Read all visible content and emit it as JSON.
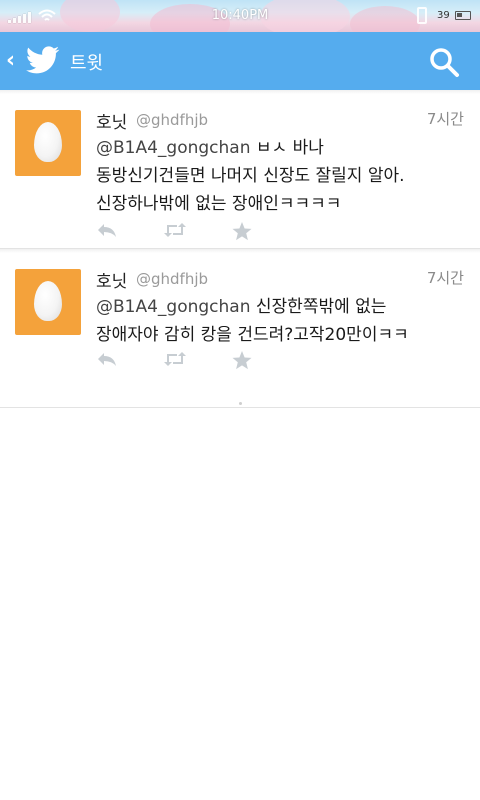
{
  "status_bar": {
    "time": "10:40PM",
    "battery_level": "39"
  },
  "app_bar": {
    "title": "트윗",
    "back_icon": "chevron-left-icon",
    "logo_icon": "twitter-bird-icon",
    "search_icon": "search-icon"
  },
  "colors": {
    "accent": "#55acee",
    "avatar_bg": "#f4a23b"
  },
  "tweets": [
    {
      "name": "호닛",
      "handle": "@ghdfhjb",
      "time": "7시간",
      "mention": "@B1A4_gongchan",
      "text": " ㅂㅅ 바나\n동방신기건들면 나머지 신장도 잘릴지 알아.\n신장하나밖에 없는 장애인ㅋㅋㅋㅋ"
    },
    {
      "name": "호닛",
      "handle": "@ghdfhjb",
      "time": "7시간",
      "mention": "@B1A4_gongchan",
      "text": " 신장한쪽밖에 없는\n장애자야 감히 캉을 건드려?고작20만이ㅋㅋ"
    }
  ],
  "action_icons": [
    "reply-icon",
    "retweet-icon",
    "favorite-star-icon"
  ]
}
